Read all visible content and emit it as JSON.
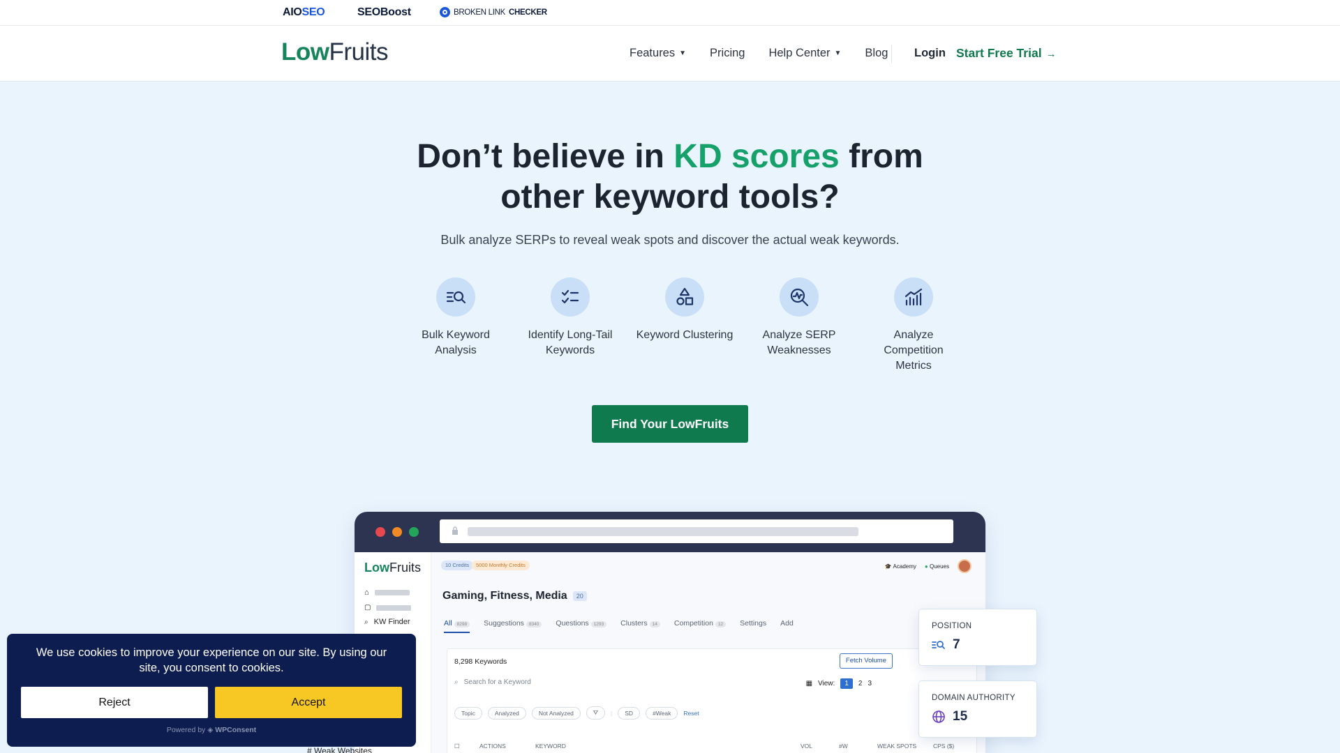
{
  "brands": {
    "aioseo_a": "AIO",
    "aioseo_b": "SEO",
    "seoboost": "SEOBoost",
    "blc_a": "BROKEN LINK",
    "blc_b": "CHECKER"
  },
  "nav": {
    "logo_low": "Low",
    "logo_fruits": "Fruits",
    "features": "Features",
    "pricing": "Pricing",
    "help": "Help Center",
    "blog": "Blog",
    "login": "Login",
    "trial": "Start Free Trial",
    "trial_arrow": "→"
  },
  "hero": {
    "title_a": "Don’t believe in ",
    "title_hl": "KD scores",
    "title_b": " from other keyword tools?",
    "subtitle": "Bulk analyze SERPs to reveal weak spots and discover the actual weak keywords.",
    "cta": "Find Your LowFruits"
  },
  "features": [
    {
      "label": "Bulk Keyword Analysis",
      "icon": "search-list-icon"
    },
    {
      "label": "Identify Long-Tail Keywords",
      "icon": "checklist-icon"
    },
    {
      "label": "Keyword Clustering",
      "icon": "shapes-icon"
    },
    {
      "label": "Analyze SERP Weaknesses",
      "icon": "magnify-pulse-icon"
    },
    {
      "label": "Analyze Competition Metrics",
      "icon": "chart-trend-icon"
    }
  ],
  "mock": {
    "logo_low": "Low",
    "logo_fruits": "Fruits",
    "credits": "10 Credits",
    "monthly": "5000 Monthly Credits",
    "academy": "Academy",
    "queues": "Queues",
    "sidebar_kw": "KW Finder",
    "project": "Gaming, Fitness, Media",
    "project_count": "20",
    "tabs": [
      {
        "label": "All",
        "count": "8298"
      },
      {
        "label": "Suggestions",
        "count": "8340"
      },
      {
        "label": "Questions",
        "count": "1293"
      },
      {
        "label": "Clusters",
        "count": "14"
      },
      {
        "label": "Competition",
        "count": "12"
      },
      {
        "label": "Settings",
        "count": ""
      },
      {
        "label": "Add",
        "count": ""
      }
    ],
    "kw_count": "8,298 Keywords",
    "fetch": "Fetch Volume",
    "search_placeholder": "Search for a Keyword",
    "view_label": "View:",
    "view_pages": [
      "1",
      "2",
      "3"
    ],
    "filters": [
      "Topic",
      "Analyzed",
      "Not Analyzed",
      "SD",
      "#Weak"
    ],
    "reset": "Reset",
    "columns": [
      "ACTIONS",
      "KEYWORD",
      "VOL",
      "#W",
      "WEAK SPOTS",
      "CPS ($)"
    ]
  },
  "cards": {
    "position_label": "POSITION",
    "position_value": "7",
    "da_label": "DOMAIN AUTHORITY",
    "da_value": "15"
  },
  "cookie": {
    "message": "We use cookies to improve your experience on our site. By using our site, you consent to cookies.",
    "reject": "Reject",
    "accept": "Accept",
    "powered": "Powered by",
    "powered_brand": "WPConsent"
  },
  "behind_text": "# Weak Websites",
  "colors": {
    "accent_green": "#0f7a4e",
    "highlight": "#16a06a",
    "bg": "#eaf4fd",
    "cookie_bg": "#0e1d4f",
    "accept": "#f7c823"
  }
}
